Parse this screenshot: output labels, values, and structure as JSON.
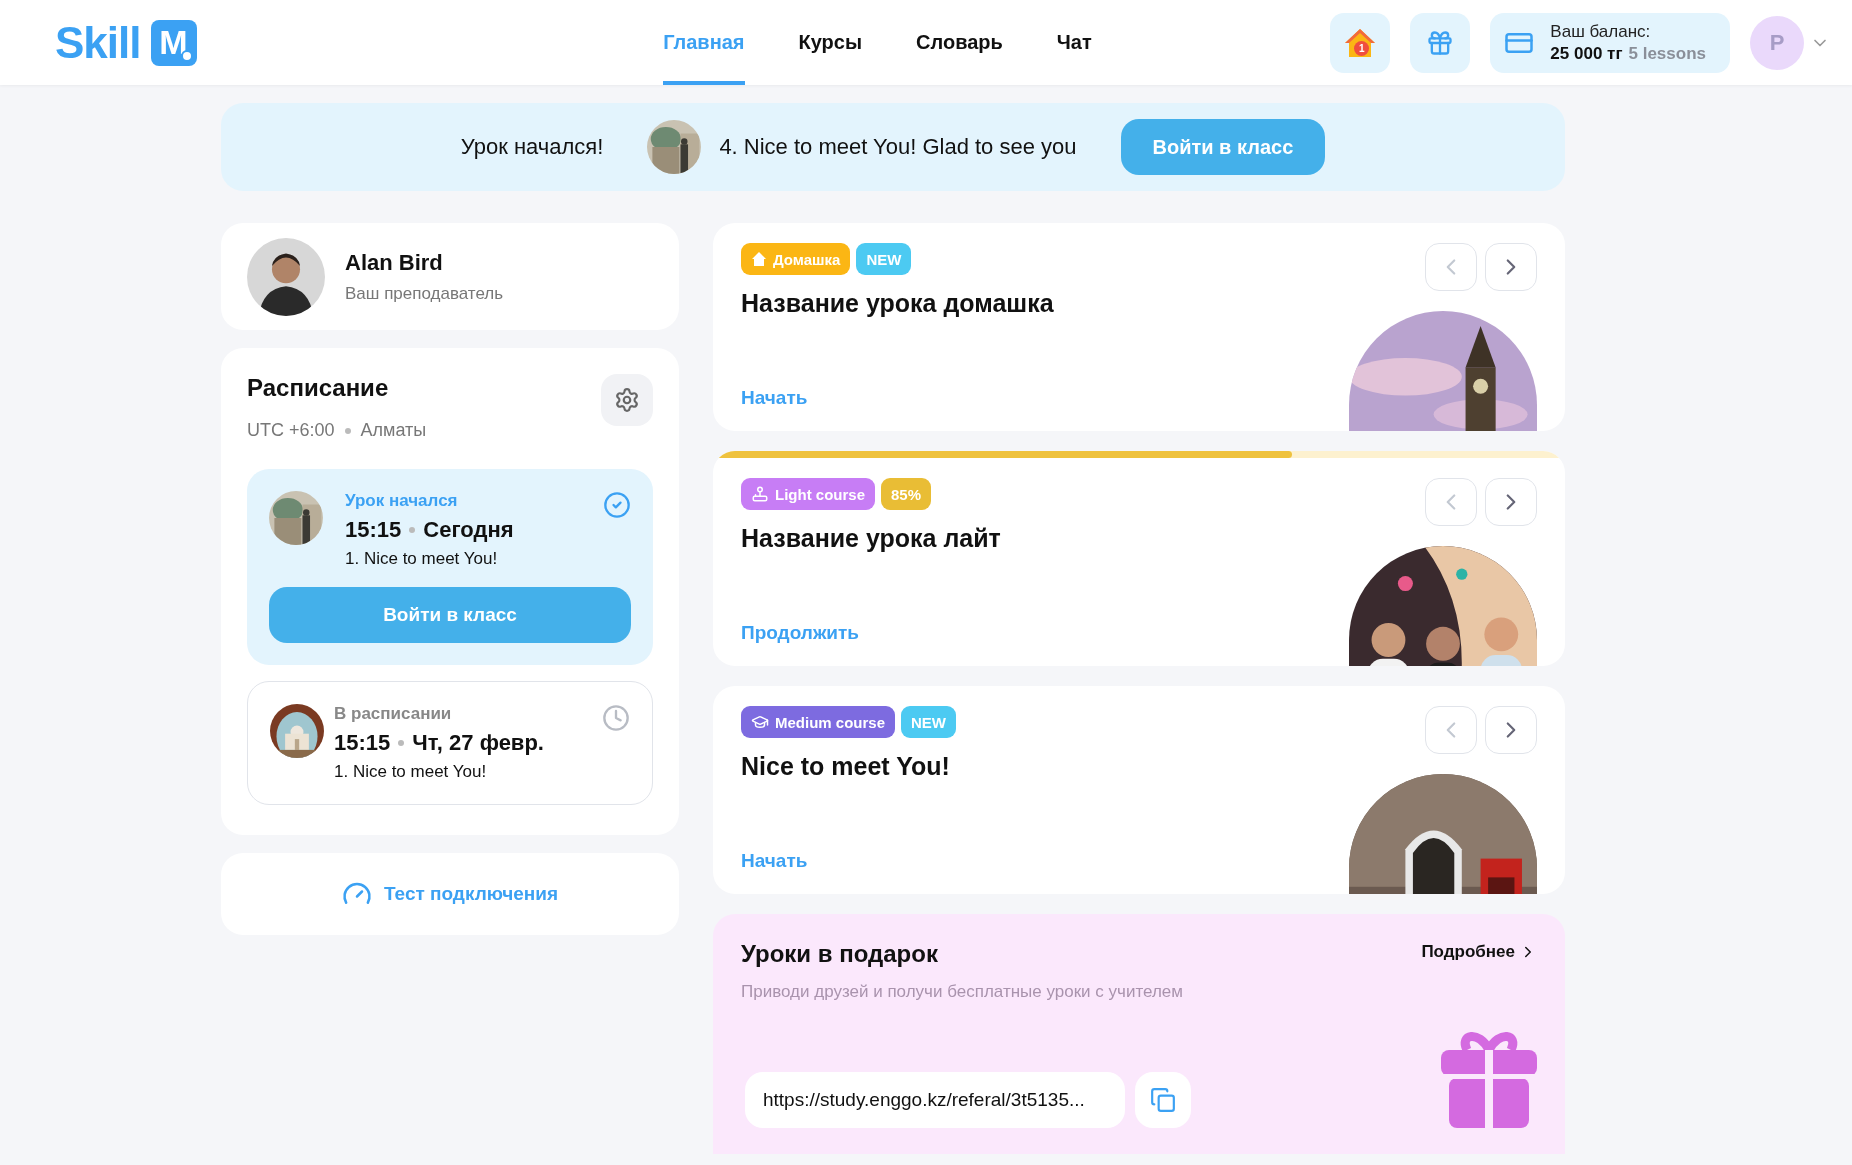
{
  "logo": {
    "text": "Skill",
    "mark": "M"
  },
  "nav": [
    {
      "label": "Главная",
      "selected": true
    },
    {
      "label": "Курсы",
      "selected": false
    },
    {
      "label": "Словарь",
      "selected": false
    },
    {
      "label": "Чат",
      "selected": false
    }
  ],
  "header": {
    "home_badge": "1",
    "balance_label": "Ваш баланс:",
    "balance_amount": "25 000 тг",
    "balance_lessons": "5 lessons",
    "avatar_letter": "P"
  },
  "banner": {
    "text": "Урок начался!",
    "lesson": "4. Nice to meet You! Glad to see you",
    "button": "Войти в класс"
  },
  "teacher": {
    "name": "Alan Bird",
    "role": "Ваш преподаватель"
  },
  "schedule": {
    "title": "Расписание",
    "timezone": "UTC +6:00",
    "city": "Алматы",
    "items": [
      {
        "kind": "started",
        "status": "Урок начался",
        "time": "15:15",
        "day": "Сегодня",
        "lesson": "1. Nice to meet You!",
        "button": "Войти в класс"
      },
      {
        "kind": "planned",
        "status": "В расписании",
        "time": "15:15",
        "day": "Чт, 27 февр.",
        "lesson": "1. Nice to meet You!"
      }
    ]
  },
  "connection_test": "Тест подключения",
  "lessons": [
    {
      "badges": [
        {
          "kind": "home",
          "label": "Домашка",
          "color": "#fbb614"
        },
        {
          "kind": "plain",
          "label": "NEW",
          "color": "#4ccaf2"
        }
      ],
      "title": "Название урока домашка",
      "action": "Начать",
      "prev_disabled": true
    },
    {
      "level": 0.68,
      "badges": [
        {
          "kind": "joystick",
          "label": "Light course",
          "color": "#c77df5"
        },
        {
          "kind": "plain",
          "label": "85%",
          "color": "#e9bd35"
        }
      ],
      "title": "Название урока лайт",
      "action": "Продолжить",
      "prev_disabled": true
    },
    {
      "badges": [
        {
          "kind": "student",
          "label": "Medium course",
          "color": "#7d6be0"
        },
        {
          "kind": "plain",
          "label": "NEW",
          "color": "#4ccaf2"
        }
      ],
      "title": "Nice to meet You!",
      "action": "Начать",
      "prev_disabled": true
    }
  ],
  "gift": {
    "title": "Уроки в подарок",
    "more": "Подробнее",
    "subtitle": "Приводи друзей и получи бесплатные уроки с учителем",
    "link": "https://study.enggo.kz/referal/3t5135..."
  }
}
